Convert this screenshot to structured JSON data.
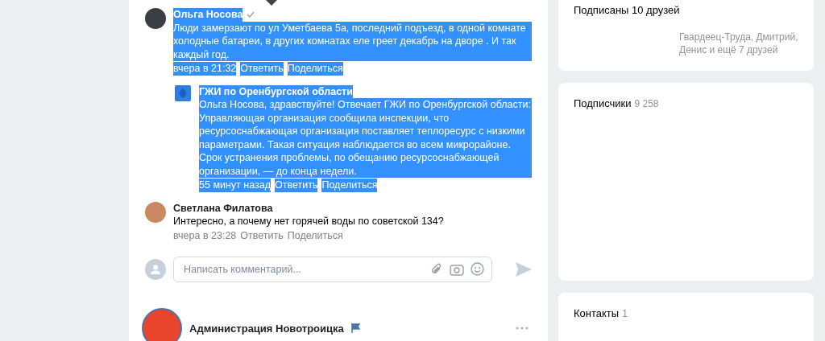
{
  "comments": [
    {
      "kind": "comment",
      "author": "Ольга Носова",
      "verified": true,
      "selected": true,
      "text": "Люди замерзают по ул Уметбаева 5а, последний подъезд, в одной комнате холодные батареи, в других комнатах еле греет декабрь на дворе . И так каждый год.",
      "time": "вчера в 21:32",
      "actions": [
        "Ответить",
        "Поделиться"
      ],
      "children": [
        {
          "kind": "reply",
          "author": "ГЖИ по Оренбургской области",
          "verified": false,
          "selected": true,
          "text": "Ольга Носова, здравствуйте! Отвечает ГЖИ по Оренбургской области: Управляющая организация сообщила инспекции, что ресурсоснабжающая организация поставляет теплоресурс с низкими параметрами. Такая ситуация наблюдается во всем микрорайоне. Срок устранения проблемы, по обещанию ресурсоснабжающей организации, — до конца недели.",
          "time": "55 минут назад",
          "actions": [
            "Ответить",
            "Поделиться"
          ]
        }
      ]
    },
    {
      "kind": "comment",
      "author": "Светлана Филатова",
      "verified": false,
      "selected": false,
      "text": "Интересно, а почему нет горячей воды по советской 134?",
      "time": "вчера в 23:28",
      "actions": [
        "Ответить",
        "Поделиться"
      ]
    }
  ],
  "comment_input": {
    "placeholder": "Написать комментарий..."
  },
  "next_post": {
    "author": "Администрация Новотроицка",
    "flag": true
  },
  "sidebar": [
    {
      "kind": "friends",
      "title": "Подписаны 10 друзей",
      "names": "Гвардеец-Труда, Дмитрий, Денис и ещё 7 друзей"
    },
    {
      "kind": "followers",
      "title": "Подписчики",
      "count": "9 258"
    },
    {
      "kind": "contacts",
      "title": "Контакты",
      "count": "1"
    }
  ]
}
